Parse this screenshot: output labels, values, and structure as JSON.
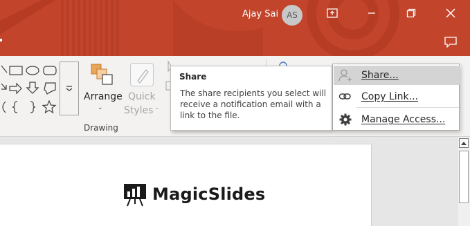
{
  "titlebar": {
    "user_name": "Ajay Sai",
    "avatar_initials": "AS",
    "accent_color": "#c2452b"
  },
  "ribbon": {
    "arrange_label": "Arrange",
    "quick_styles_line1": "Quick",
    "quick_styles_line2": "Styles",
    "drawing_group_label": "Drawing",
    "shapes_gallery_icons": [
      "line-shape-icon",
      "rectangle-shape-icon",
      "oval-shape-icon",
      "rounded-rectangle-shape-icon",
      "arrow-shape-icon",
      "right-arrow-shape-icon",
      "down-arrow-shape-icon",
      "callout-shape-icon",
      "curve-shape-icon",
      "left-brace-shape-icon",
      "right-brace-shape-icon",
      "star-shape-icon"
    ]
  },
  "tooltip": {
    "title": "Share",
    "body": "The share recipients you select will receive a notification email with a link to the file."
  },
  "share_menu": {
    "items": [
      {
        "label": "Share...",
        "icon": "share-person-icon",
        "hovered": true
      },
      {
        "label": "Copy Link...",
        "icon": "link-icon",
        "hovered": false
      },
      {
        "label": "Manage Access...",
        "icon": "gear-icon",
        "hovered": false
      }
    ]
  },
  "slide": {
    "logo_text": "MagicSlides"
  }
}
